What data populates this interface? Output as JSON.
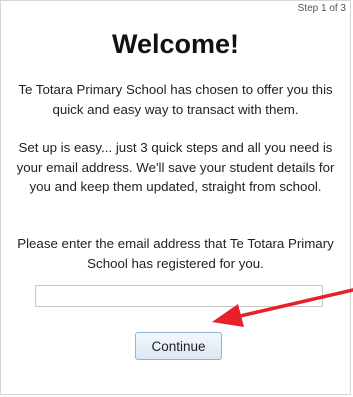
{
  "step_indicator": "Step 1 of 3",
  "title": "Welcome!",
  "paragraphs": [
    "Te Totara Primary School has chosen to offer you this quick and easy way to transact with them.",
    "Set up is easy... just 3 quick steps and all you need is your email address. We'll save your student details for you and keep them updated, straight from school.",
    "Please enter the email address that Te Totara Primary School has registered for you."
  ],
  "email_field": {
    "value": "",
    "placeholder": ""
  },
  "continue_label": "Continue",
  "colors": {
    "annotation_arrow": "#e8202a",
    "button_border": "#8fb3d9"
  },
  "icons": {
    "annotation": "red-arrow-icon"
  }
}
